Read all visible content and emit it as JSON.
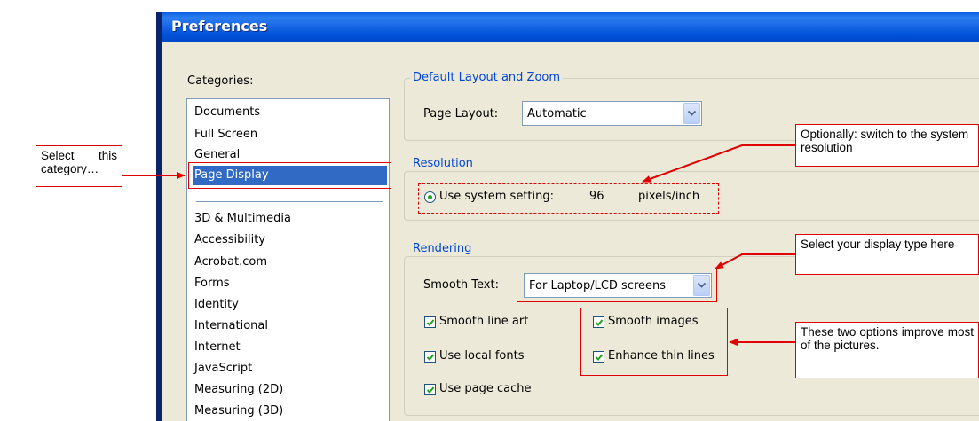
{
  "dialog": {
    "title": "Preferences"
  },
  "categories": {
    "label": "Categories:",
    "group1": [
      "Documents",
      "Full Screen",
      "General"
    ],
    "selected": "Page Display",
    "group2": [
      "3D & Multimedia",
      "Accessibility",
      "Acrobat.com",
      "Forms",
      "Identity",
      "International",
      "Internet",
      "JavaScript",
      "Measuring (2D)",
      "Measuring (3D)"
    ]
  },
  "layout_group": {
    "title": "Default Layout and Zoom",
    "page_layout_label": "Page Layout:",
    "page_layout_value": "Automatic"
  },
  "resolution_group": {
    "title": "Resolution",
    "option_label": "Use system setting:",
    "value": "96",
    "unit": "pixels/inch"
  },
  "rendering_group": {
    "title": "Rendering",
    "smooth_text_label": "Smooth Text:",
    "smooth_text_value": "For Laptop/LCD screens",
    "checkboxes": {
      "smooth_line_art": "Smooth line art",
      "smooth_images": "Smooth images",
      "use_local_fonts": "Use local fonts",
      "enhance_thin_lines": "Enhance thin lines",
      "use_page_cache": "Use page cache"
    }
  },
  "annotations": {
    "select_category": "Select this category…",
    "resolution_note": "Optionally: switch to the system resolution",
    "display_type_note": "Select your display type here",
    "options_note": "These two options improve most of the pictures."
  },
  "colors": {
    "annotation": "#e00000",
    "selection": "#316ac5",
    "titlebar": "#0058e6",
    "group_title": "#0046d5"
  }
}
